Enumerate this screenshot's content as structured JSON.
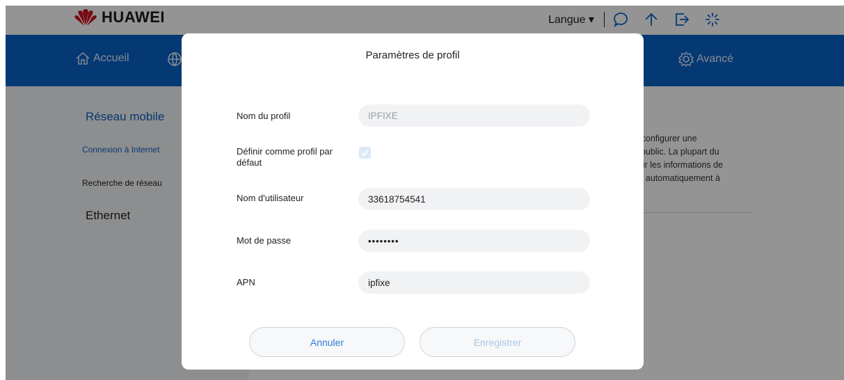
{
  "header": {
    "brand": "HUAWEI",
    "language": "Langue ▾",
    "icons": [
      "chat-icon",
      "upload-arrow-icon",
      "logout-icon",
      "loading-icon"
    ]
  },
  "nav": {
    "home": "Accueil",
    "advanced": "Avancé"
  },
  "sidebar": {
    "title": "Réseau mobile",
    "items": [
      {
        "label": "Connexion à Internet"
      },
      {
        "label": "Recherche de réseau"
      }
    ],
    "ethernet": "Ethernet"
  },
  "main": {
    "info_lines": [
      "r configurer une",
      "t public. La plupart du",
      "plir les informations de",
      "te automatiquement à"
    ]
  },
  "dialog": {
    "title": "Paramètres de profil",
    "fields": {
      "profile_name": {
        "label": "Nom du profil",
        "value": "IPFIXE"
      },
      "default_profile": {
        "label": "Définir comme profil par défaut",
        "checked": true
      },
      "username": {
        "label": "Nom d'utilisateur",
        "value": "33618754541"
      },
      "password": {
        "label": "Mot de passe",
        "value": "••••••••"
      },
      "apn": {
        "label": "APN",
        "value": "ipfixe"
      }
    },
    "buttons": {
      "cancel": "Annuler",
      "save": "Enregistrer"
    }
  },
  "colors": {
    "accent": "#0a63c9",
    "brand_red": "#cf1322"
  }
}
